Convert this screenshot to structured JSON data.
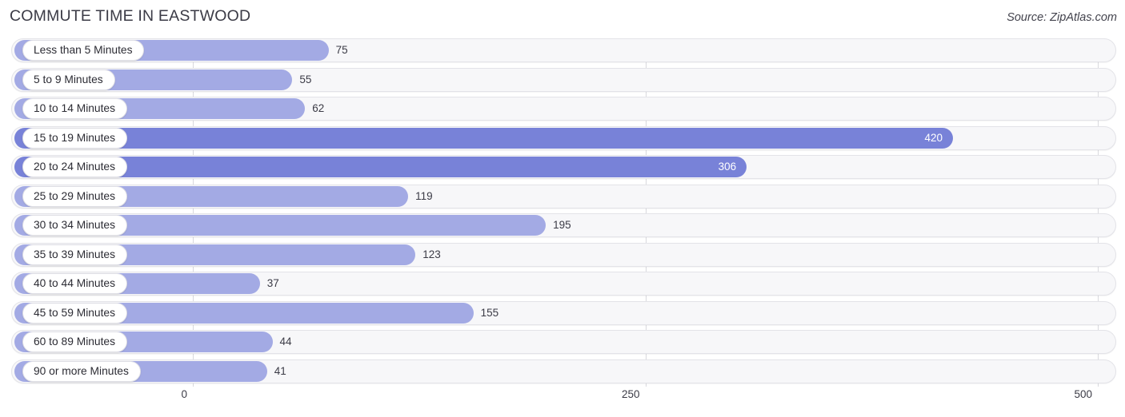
{
  "header": {
    "title": "COMMUTE TIME IN EASTWOOD",
    "source": "Source: ZipAtlas.com"
  },
  "colors": {
    "bar_light": "#a3aae4",
    "bar_dark": "#7882d8",
    "track": "#f7f7f9",
    "track_border": "#e3e3e8",
    "gridline": "#d9d9de",
    "text": "#3b3b46",
    "value_inside": "#ffffff"
  },
  "chart_data": {
    "type": "bar",
    "orientation": "horizontal",
    "title": "COMMUTE TIME IN EASTWOOD",
    "xlabel": "",
    "ylabel": "",
    "xlim": [
      0,
      500
    ],
    "grid": true,
    "legend": null,
    "xticks": [
      "0",
      "250",
      "500"
    ],
    "xtick_values": [
      0,
      250,
      500
    ],
    "categories": [
      "Less than 5 Minutes",
      "5 to 9 Minutes",
      "10 to 14 Minutes",
      "15 to 19 Minutes",
      "20 to 24 Minutes",
      "25 to 29 Minutes",
      "30 to 34 Minutes",
      "35 to 39 Minutes",
      "40 to 44 Minutes",
      "45 to 59 Minutes",
      "60 to 89 Minutes",
      "90 or more Minutes"
    ],
    "values": [
      75,
      55,
      62,
      420,
      306,
      119,
      195,
      123,
      37,
      155,
      44,
      41
    ],
    "value_labels": [
      "75",
      "55",
      "62",
      "420",
      "306",
      "119",
      "195",
      "123",
      "37",
      "155",
      "44",
      "41"
    ],
    "label_inside": [
      false,
      false,
      false,
      true,
      true,
      false,
      false,
      false,
      false,
      false,
      false,
      false
    ]
  }
}
